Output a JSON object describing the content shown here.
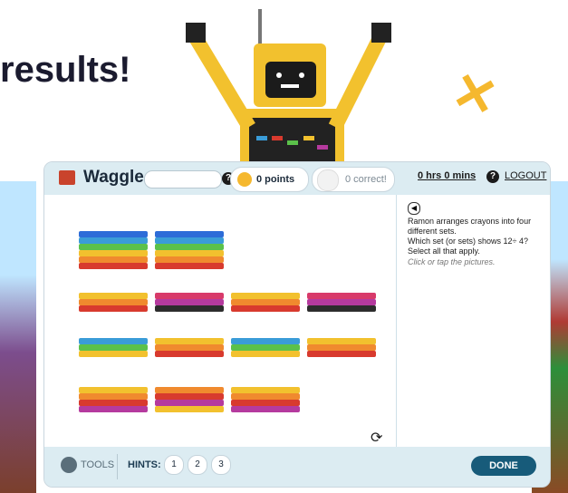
{
  "background": {
    "headline": "results!"
  },
  "app": {
    "name": "Waggle",
    "points_label": "0 points",
    "correct_label": "0 correct!",
    "time_label": "0 hrs 0 mins",
    "logout_label": "LOGOUT",
    "help_icon": "question-icon",
    "question": {
      "lines": [
        "Ramon arranges crayons into four",
        "different sets.",
        "Which set (or sets) shows 12÷ 4?",
        "Select all that apply."
      ],
      "hint": "Click or tap the pictures."
    },
    "bottom": {
      "tools_label": "TOOLS",
      "hints_label": "HINTS:",
      "hint_buttons": [
        "1",
        "2",
        "3"
      ],
      "done_label": "DONE"
    },
    "crayon_sets": [
      {
        "groups": [
          [
            "#2d6cd8",
            "#3a9cd8",
            "#5bc14a",
            "#f2c12e",
            "#f08a2e",
            "#d83a2e"
          ],
          [
            "#2d6cd8",
            "#3a9cd8",
            "#5bc14a",
            "#f2c12e",
            "#f08a2e",
            "#d83a2e"
          ]
        ]
      },
      {
        "groups": [
          [
            "#f2c12e",
            "#f08a2e",
            "#d83a2e"
          ],
          [
            "#d83a6a",
            "#b53a9e",
            "#2d2d2d"
          ],
          [
            "#f2c12e",
            "#f08a2e",
            "#d83a2e"
          ],
          [
            "#d83a6a",
            "#b53a9e",
            "#2d2d2d"
          ]
        ]
      },
      {
        "groups": [
          [
            "#3a9cd8",
            "#5bc14a",
            "#f2c12e"
          ],
          [
            "#f2c12e",
            "#f08a2e",
            "#d83a2e"
          ],
          [
            "#3a9cd8",
            "#5bc14a",
            "#f2c12e"
          ],
          [
            "#f2c12e",
            "#f08a2e",
            "#d83a2e"
          ]
        ]
      },
      {
        "groups": [
          [
            "#f2c12e",
            "#f08a2e",
            "#d83a2e",
            "#b53a9e"
          ],
          [
            "#f08a2e",
            "#d83a2e",
            "#b53a9e",
            "#f2c12e"
          ],
          [
            "#f2c12e",
            "#f08a2e",
            "#d83a2e",
            "#b53a9e"
          ]
        ]
      }
    ]
  }
}
